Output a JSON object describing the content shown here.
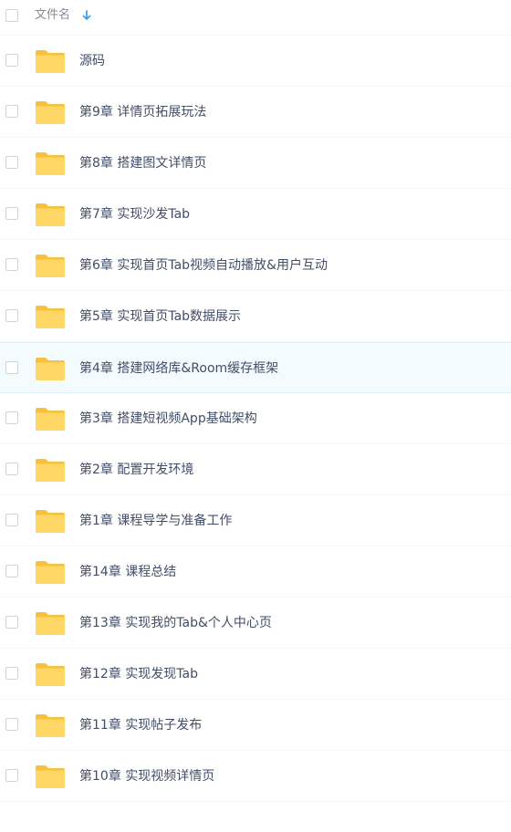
{
  "header": {
    "column_label": "文件名",
    "sort_icon": "arrow-down-icon",
    "sort_color": "#3fa0f0"
  },
  "colors": {
    "folder_front": "#ffd766",
    "folder_back": "#f5c13f",
    "hover_row": "#f4fbff"
  },
  "files": [
    {
      "name": "源码",
      "icon": "folder-icon"
    },
    {
      "name": "第9章 详情页拓展玩法",
      "icon": "folder-icon"
    },
    {
      "name": "第8章 搭建图文详情页",
      "icon": "folder-icon"
    },
    {
      "name": "第7章 实现沙发Tab",
      "icon": "folder-icon"
    },
    {
      "name": "第6章 实现首页Tab视频自动播放&用户互动",
      "icon": "folder-icon"
    },
    {
      "name": "第5章 实现首页Tab数据展示",
      "icon": "folder-icon"
    },
    {
      "name": "第4章 搭建网络库&Room缓存框架",
      "icon": "folder-icon",
      "hovered": true
    },
    {
      "name": "第3章 搭建短视频App基础架构",
      "icon": "folder-icon"
    },
    {
      "name": "第2章 配置开发环境",
      "icon": "folder-icon"
    },
    {
      "name": "第1章 课程导学与准备工作",
      "icon": "folder-icon"
    },
    {
      "name": "第14章 课程总结",
      "icon": "folder-icon"
    },
    {
      "name": "第13章 实现我的Tab&个人中心页",
      "icon": "folder-icon"
    },
    {
      "name": "第12章 实现发现Tab",
      "icon": "folder-icon"
    },
    {
      "name": "第11章 实现帖子发布",
      "icon": "folder-icon"
    },
    {
      "name": "第10章 实现视频详情页",
      "icon": "folder-icon"
    }
  ]
}
